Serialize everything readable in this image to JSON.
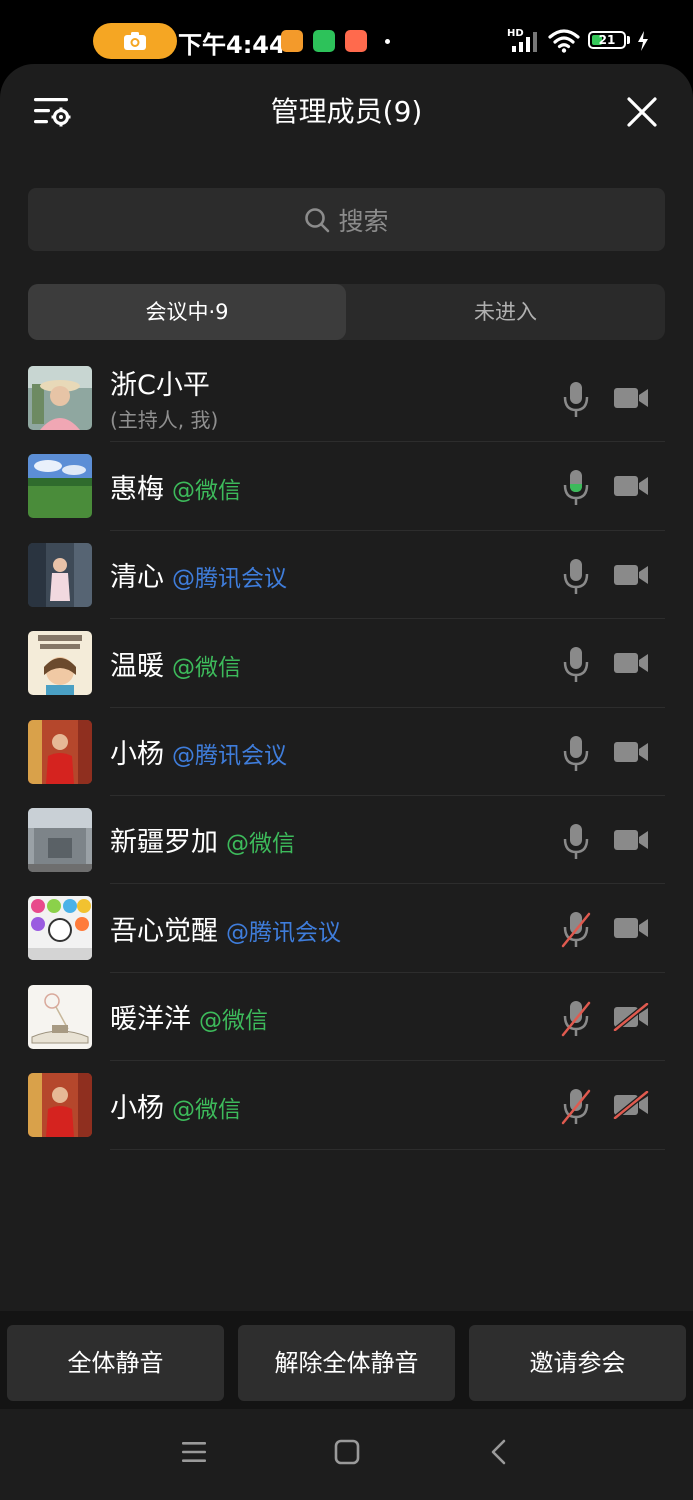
{
  "status_bar": {
    "time": "下午4:44",
    "battery": "21",
    "network": "HD"
  },
  "header": {
    "title": "管理成员(9)"
  },
  "search": {
    "placeholder": "搜索"
  },
  "tabs": [
    {
      "label": "会议中·9",
      "active": true
    },
    {
      "label": "未进入",
      "active": false
    }
  ],
  "participants": [
    {
      "name": "浙C小平",
      "subtitle": "(主持人, 我)",
      "source": "",
      "mic": "on",
      "camera": "on"
    },
    {
      "name": "惠梅",
      "source": "@微信",
      "mic": "speaking",
      "camera": "on"
    },
    {
      "name": "清心",
      "source": "@腾讯会议",
      "mic": "on",
      "camera": "on"
    },
    {
      "name": "温暖",
      "source": "@微信",
      "mic": "on",
      "camera": "on"
    },
    {
      "name": "小杨",
      "source": "@腾讯会议",
      "mic": "on",
      "camera": "on"
    },
    {
      "name": "新疆罗加",
      "source": "@微信",
      "mic": "on",
      "camera": "on"
    },
    {
      "name": "吾心觉醒",
      "source": "@腾讯会议",
      "mic": "muted",
      "camera": "on"
    },
    {
      "name": "暖洋洋",
      "source": "@微信",
      "mic": "muted",
      "camera": "off"
    },
    {
      "name": "小杨",
      "source": "@微信",
      "mic": "muted",
      "camera": "off"
    }
  ],
  "footer": {
    "mute_all": "全体静音",
    "unmute_all": "解除全体静音",
    "invite": "邀请参会"
  },
  "colors": {
    "wechat_tag": "#3dba5b",
    "tencent_tag": "#3f7ddb",
    "muted_slash": "#e05a4f",
    "speaking": "#3dba5b"
  }
}
